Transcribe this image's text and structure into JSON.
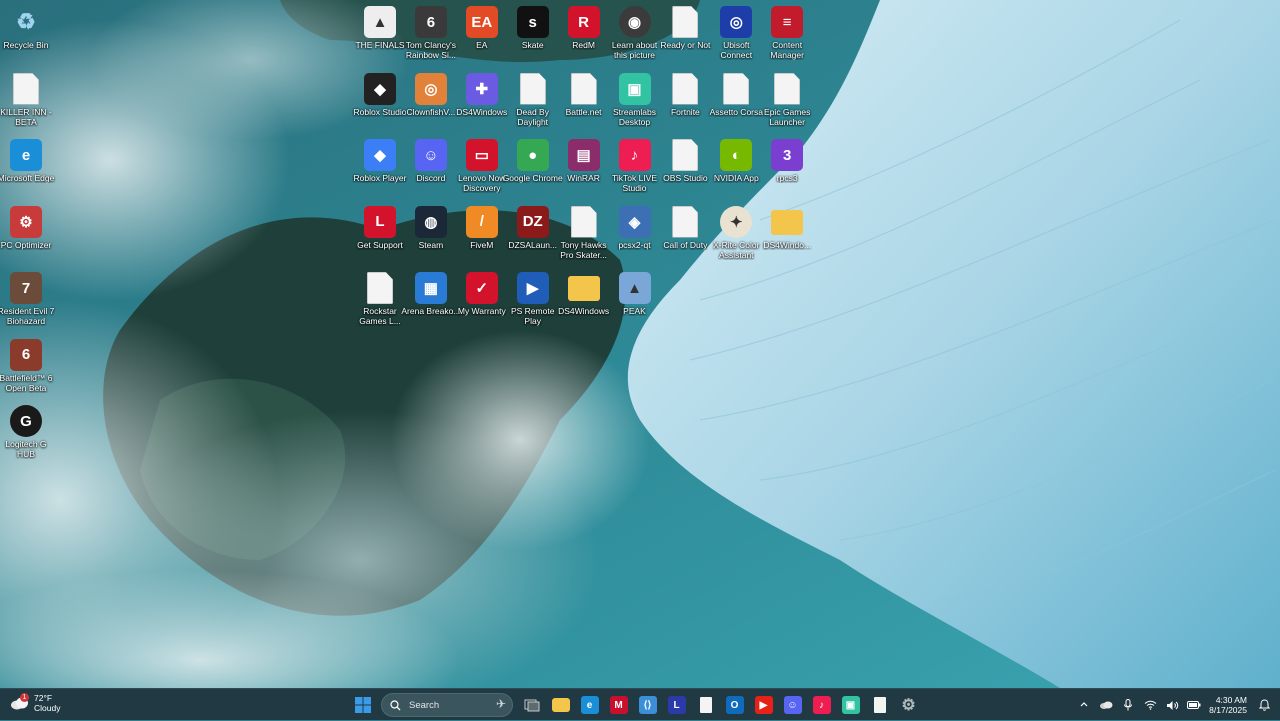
{
  "desktop": {
    "left_column": [
      {
        "label": "Recycle Bin",
        "icon": "recycle-bin-icon",
        "color": "#9fd3f0"
      },
      {
        "label": "KILLER INN - BETA",
        "icon": "file-icon",
        "color": "#f4f4f4"
      },
      {
        "label": "Microsoft Edge",
        "icon": "edge-icon",
        "color": "#1a8fd8"
      },
      {
        "label": "PC Optimizer",
        "icon": "pc-optimizer-icon",
        "color": "#c73b3b"
      },
      {
        "label": "Resident Evil 7 Biohazard",
        "icon": "resident-evil-icon",
        "color": "#6b4b3a"
      },
      {
        "label": "Battlefield™ 6 Open Beta",
        "icon": "battlefield-icon",
        "color": "#8a3b2b"
      },
      {
        "label": "Logitech G HUB",
        "icon": "logitech-g-icon",
        "color": "#1a1a1a"
      }
    ],
    "grid_rows": [
      [
        {
          "label": "THE FINALS",
          "icon": "the-finals-icon",
          "color": "#eeeeee"
        },
        {
          "label": "Tom Clancy's Rainbow Si...",
          "icon": "rainbow-six-icon",
          "color": "#3a3a3a"
        },
        {
          "label": "EA",
          "icon": "ea-icon",
          "color": "#e34b26"
        },
        {
          "label": "Skate",
          "icon": "skate-icon",
          "color": "#111111"
        },
        {
          "label": "RedM",
          "icon": "redm-icon",
          "color": "#d3122b"
        },
        {
          "label": "Learn about this picture",
          "icon": "learn-picture-icon",
          "color": "#3b3b3b"
        },
        {
          "label": "Ready or Not",
          "icon": "file-icon",
          "color": "#f4f4f4"
        },
        {
          "label": "Ubisoft Connect",
          "icon": "ubisoft-icon",
          "color": "#1d3ea8"
        },
        {
          "label": "Content Manager",
          "icon": "content-manager-icon",
          "color": "#c21c2c"
        }
      ],
      [
        {
          "label": "Roblox Studio",
          "icon": "roblox-studio-icon",
          "color": "#222222"
        },
        {
          "label": "ClownfishV...",
          "icon": "clownfish-icon",
          "color": "#e2823a"
        },
        {
          "label": "DS4Windows",
          "icon": "gamepad-icon",
          "color": "#6b5be3"
        },
        {
          "label": "Dead By Daylight",
          "icon": "file-icon",
          "color": "#f4f4f4"
        },
        {
          "label": "Battle.net",
          "icon": "file-icon",
          "color": "#f4f4f4"
        },
        {
          "label": "Streamlabs Desktop",
          "icon": "streamlabs-icon",
          "color": "#31c3a2"
        },
        {
          "label": "Fortnite",
          "icon": "file-icon",
          "color": "#f4f4f4"
        },
        {
          "label": "Assetto Corsa",
          "icon": "file-icon",
          "color": "#f4f4f4"
        },
        {
          "label": "Epic Games Launcher",
          "icon": "file-icon",
          "color": "#f4f4f4"
        }
      ],
      [
        {
          "label": "Roblox Player",
          "icon": "roblox-icon",
          "color": "#3c7ef5"
        },
        {
          "label": "Discord",
          "icon": "discord-icon",
          "color": "#5865f2"
        },
        {
          "label": "Lenovo Now Discovery",
          "icon": "lenovo-icon",
          "color": "#d3122b"
        },
        {
          "label": "Google Chrome",
          "icon": "chrome-icon",
          "color": "#34a853"
        },
        {
          "label": "WinRAR",
          "icon": "winrar-icon",
          "color": "#8b2c6b"
        },
        {
          "label": "TikTok LIVE Studio",
          "icon": "tiktok-icon",
          "color": "#ee1d52"
        },
        {
          "label": "OBS Studio",
          "icon": "file-icon",
          "color": "#f4f4f4"
        },
        {
          "label": "NVIDIA App",
          "icon": "nvidia-icon",
          "color": "#76b900"
        },
        {
          "label": "rpcs3",
          "icon": "rpcs3-icon",
          "color": "#7a3fd1"
        }
      ],
      [
        {
          "label": "Get Support",
          "icon": "get-support-icon",
          "color": "#d3122b"
        },
        {
          "label": "Steam",
          "icon": "steam-icon",
          "color": "#1b2838"
        },
        {
          "label": "FiveM",
          "icon": "fivem-icon",
          "color": "#f08a24"
        },
        {
          "label": "DZSALaun...",
          "icon": "dzsa-icon",
          "color": "#8b1a1a"
        },
        {
          "label": "Tony Hawks Pro Skater...",
          "icon": "file-icon",
          "color": "#f4f4f4"
        },
        {
          "label": "pcsx2-qt",
          "icon": "pcsx2-icon",
          "color": "#3d6fb4"
        },
        {
          "label": "Call of Duty",
          "icon": "file-icon",
          "color": "#f4f4f4"
        },
        {
          "label": "X-Rite Color Assistant",
          "icon": "xrite-icon",
          "color": "#e9e2d0"
        },
        {
          "label": "DS4Windo...",
          "icon": "folder-icon",
          "color": "#f3c64b"
        }
      ],
      [
        {
          "label": "Rockstar Games L...",
          "icon": "file-icon",
          "color": "#f4f4f4"
        },
        {
          "label": "Arena Breako...",
          "icon": "arena-breakout-icon",
          "color": "#2a7bd6"
        },
        {
          "label": "My Warranty",
          "icon": "warranty-icon",
          "color": "#d3122b"
        },
        {
          "label": "PS Remote Play",
          "icon": "ps-remote-icon",
          "color": "#1f5db8"
        },
        {
          "label": "DS4Windows",
          "icon": "folder-icon",
          "color": "#f3c64b"
        },
        {
          "label": "PEAK",
          "icon": "peak-icon",
          "color": "#7aa6d8"
        }
      ]
    ]
  },
  "taskbar": {
    "weather": {
      "temp": "72°F",
      "condition": "Cloudy",
      "badge": "1"
    },
    "search": {
      "placeholder": "Search"
    },
    "pinned": [
      {
        "name": "start-button",
        "icon": "windows-logo-icon",
        "color": "#3a9ce8"
      },
      {
        "name": "task-view-button",
        "icon": "task-view-icon",
        "color": "#c8c8c8"
      },
      {
        "name": "file-explorer-button",
        "icon": "folder-icon",
        "color": "#f3c64b"
      },
      {
        "name": "edge-button",
        "icon": "edge-icon",
        "color": "#1a8fd8"
      },
      {
        "name": "mcafee-button",
        "icon": "shield-icon",
        "color": "#c8102e"
      },
      {
        "name": "vscode-button",
        "icon": "code-icon",
        "color": "#3b8fd6"
      },
      {
        "name": "lenovo-button",
        "icon": "lenovo-l-icon",
        "color": "#2a3aa8"
      },
      {
        "name": "notepad-button",
        "icon": "file-icon",
        "color": "#f4f4f4"
      },
      {
        "name": "outlook-button",
        "icon": "outlook-icon",
        "color": "#0f6cbd"
      },
      {
        "name": "youtube-button",
        "icon": "youtube-icon",
        "color": "#e62117"
      },
      {
        "name": "discord-button",
        "icon": "discord-icon",
        "color": "#5865f2"
      },
      {
        "name": "tiktok-button",
        "icon": "tiktok-icon",
        "color": "#ee1d52"
      },
      {
        "name": "streamlabs-button",
        "icon": "streamlabs-icon",
        "color": "#31c3a2"
      },
      {
        "name": "document-button",
        "icon": "file-icon",
        "color": "#f4f4f4"
      },
      {
        "name": "settings-button",
        "icon": "gear-icon",
        "color": "#b0b8bc"
      }
    ],
    "clock": {
      "time": "4:30 AM",
      "date": "8/17/2025"
    }
  }
}
